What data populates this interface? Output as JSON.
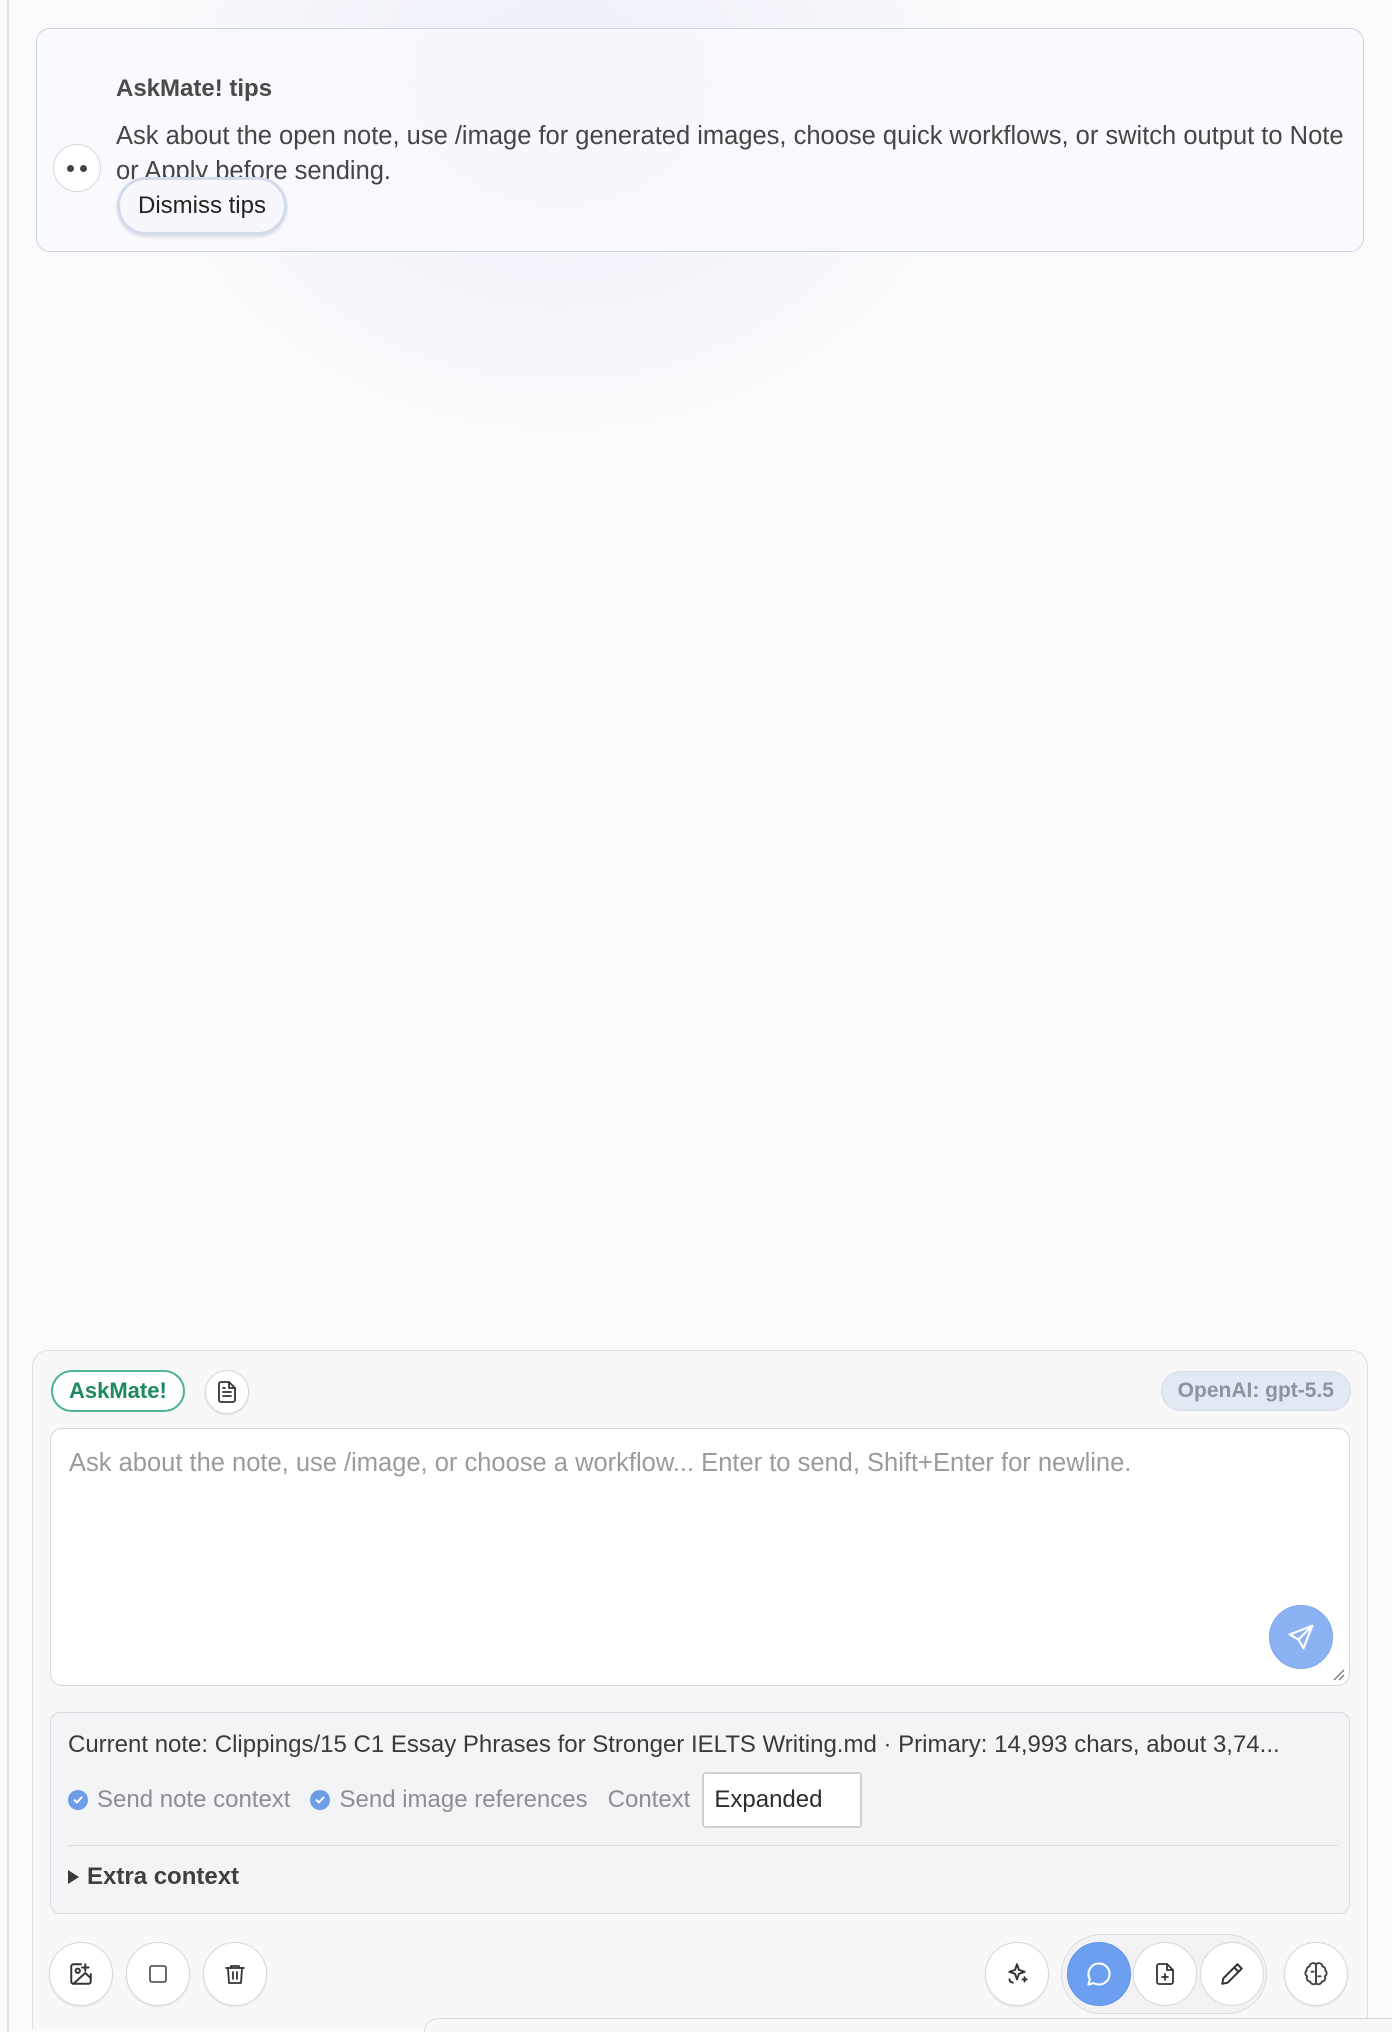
{
  "tips": {
    "title": "AskMate! tips",
    "body": "Ask about the open note, use /image for generated images, choose quick workflows, or switch output to Note or Apply before sending.",
    "dismiss_label": "Dismiss tips"
  },
  "composer": {
    "brand_label": "AskMate!",
    "model_label": "OpenAI: gpt-5.5",
    "prompt_placeholder": "Ask about the note, use /image, or choose a workflow... Enter to send, Shift+Enter for newline.",
    "prompt_value": ""
  },
  "context": {
    "current_note": "Current note: Clippings/15 C1 Essay Phrases for Stronger IELTS Writing.md · Primary: 14,993 chars, about 3,74...",
    "send_note_context": {
      "label": "Send note context",
      "checked": true
    },
    "send_image_refs": {
      "label": "Send image references",
      "checked": true
    },
    "context_label": "Context",
    "context_value": "Expanded",
    "extra_label": "Extra context"
  },
  "toolbar": {
    "left": [
      "image-plus-icon",
      "square-icon",
      "trash-icon"
    ],
    "right": [
      "sparkle-icon",
      "chat-bubble-icon",
      "file-plus-icon",
      "pencil-icon",
      "brain-icon"
    ],
    "active_mode": "chat",
    "accent_color": "#6c9ff0",
    "brand_color": "#1d8a5d"
  }
}
